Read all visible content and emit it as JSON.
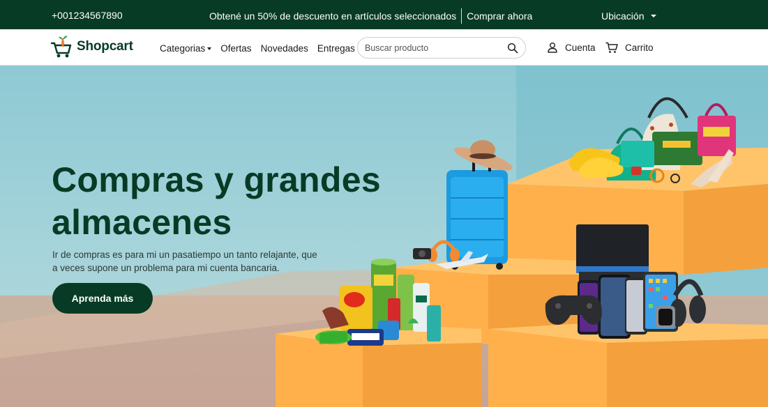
{
  "topbar": {
    "phone": "+001234567890",
    "promo_text": "Obtené un 50% de descuento en artículos seleccionados",
    "promo_link": "Comprar ahora",
    "location": "Ubicación"
  },
  "header": {
    "brand": "Shopcart",
    "nav": {
      "categories": "Categorias",
      "deals": "Ofertas",
      "news": "Novedades",
      "delivery": "Entregas"
    },
    "search_placeholder": "Buscar producto",
    "account": "Cuenta",
    "cart": "Carrito"
  },
  "hero": {
    "title": "Compras y grandes almacenes",
    "subtitle": "Ir de compras es para mi un pasatiempo un tanto relajante, que a veces supone un problema para mi cuenta bancaria.",
    "button": "Aprenda más"
  },
  "colors": {
    "brand_green": "#073b25",
    "hero_sky": "#8ec9d4",
    "box_orange": "#ffb84d"
  }
}
